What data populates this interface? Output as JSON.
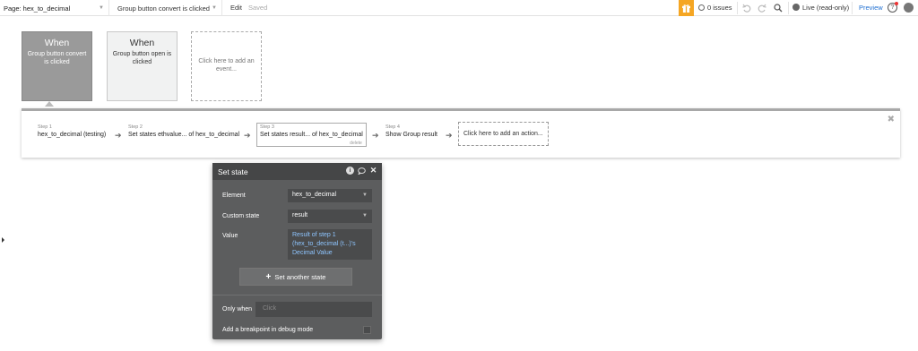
{
  "topbar": {
    "page_label": "Page: hex_to_decimal",
    "event_label": "Group button convert is clicked",
    "edit_label": "Edit",
    "saved_label": "Saved",
    "issues_label": "0 issues",
    "live_label": "Live (read-only)",
    "preview_label": "Preview",
    "help_label": "?",
    "accent_color": "#f5a623",
    "preview_color": "#1f6fd1"
  },
  "events": [
    {
      "when": "When",
      "desc": "Group button convert is clicked"
    },
    {
      "when": "When",
      "desc": "Group button open is clicked"
    },
    {
      "desc": "Click here to add an event..."
    }
  ],
  "steps": [
    {
      "num": "Step 1",
      "title": "hex_to_decimal (testing)"
    },
    {
      "num": "Step 2",
      "title": "Set states ethvalue... of hex_to_decimal"
    },
    {
      "num": "Step 3",
      "title": "Set states result... of hex_to_decimal",
      "delete": "delete"
    },
    {
      "num": "Step 4",
      "title": "Show Group result"
    },
    {
      "title": "Click here to add an action..."
    }
  ],
  "dialog": {
    "title": "Set state",
    "element_label": "Element",
    "element_value": "hex_to_decimal",
    "custom_state_label": "Custom state",
    "custom_state_value": "result",
    "value_label": "Value",
    "value_line1": "Result of step 1",
    "value_line2": "(hex_to_decimal (t...)'s",
    "value_line3": "Decimal Value",
    "add_state_label": "Set another state",
    "only_when_label": "Only when",
    "only_when_placeholder": "Click",
    "breakpoint_label": "Add a breakpoint in debug mode"
  }
}
